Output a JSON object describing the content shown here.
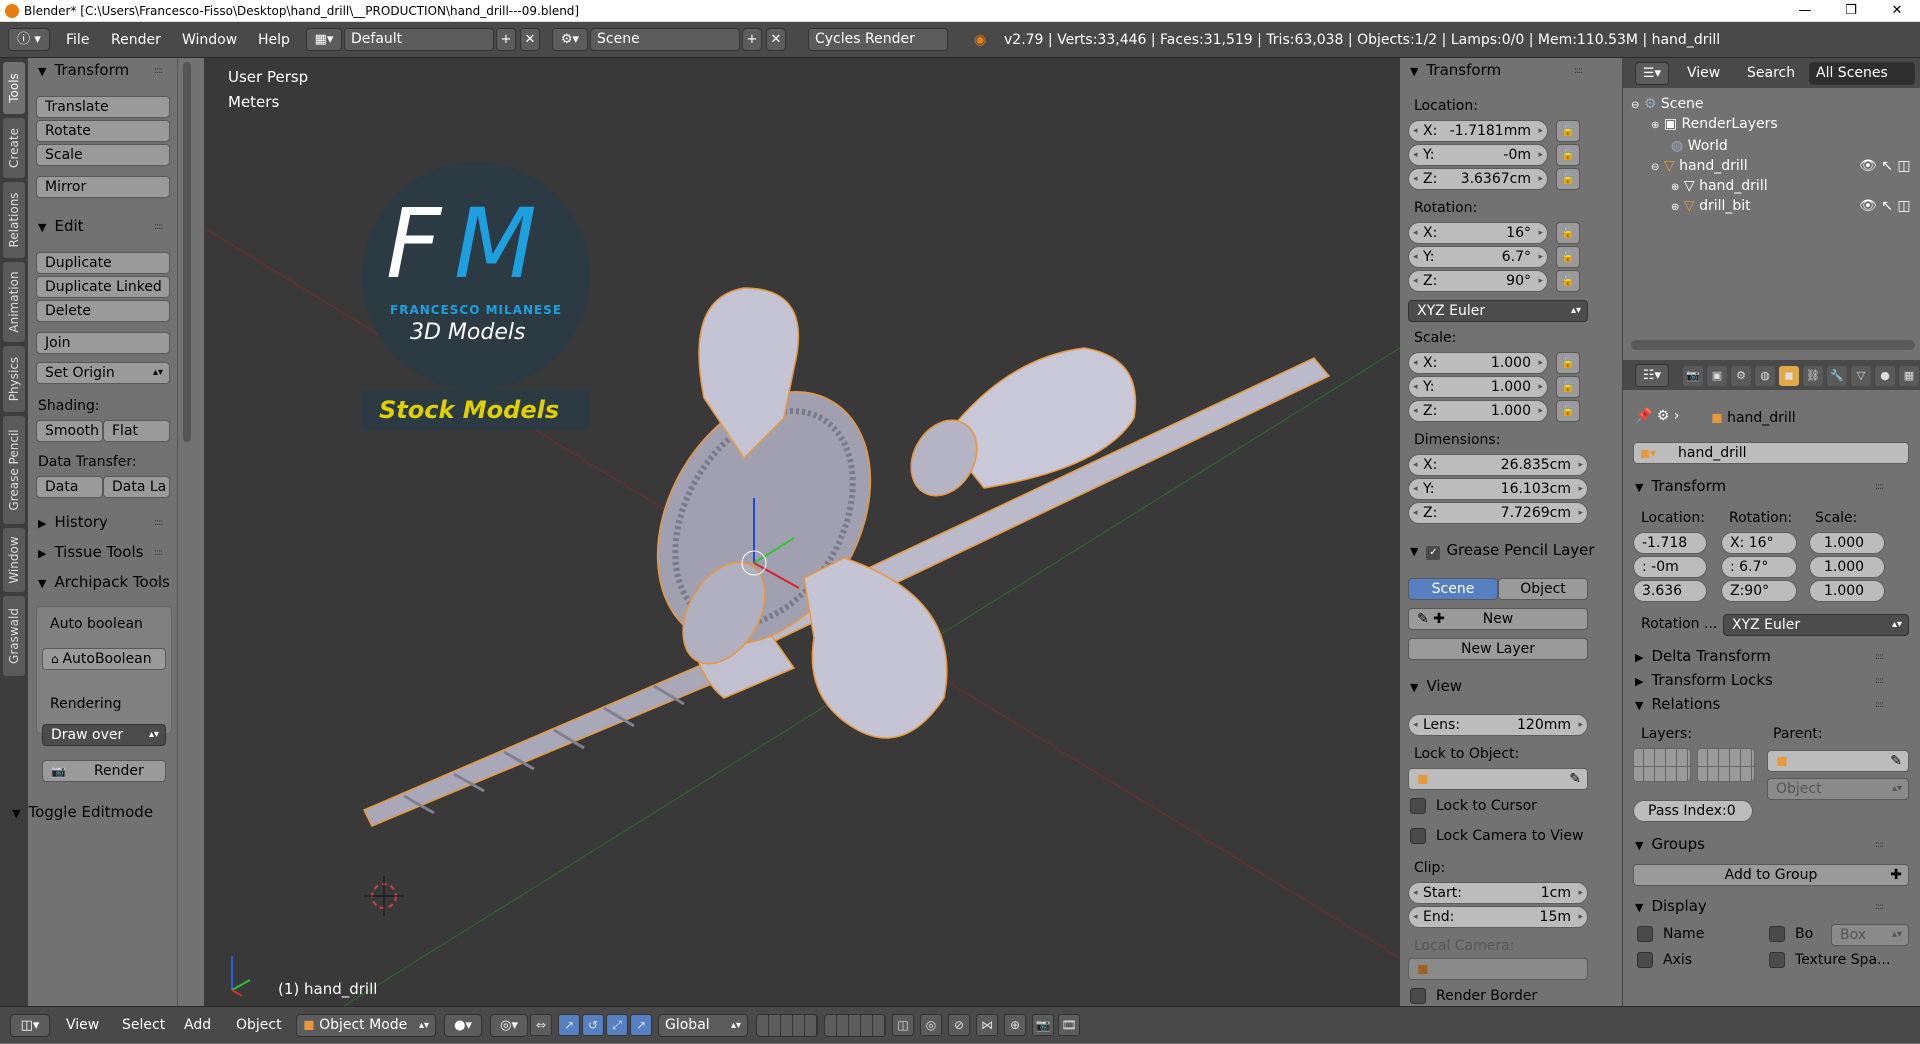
{
  "title_bar": {
    "title": "Blender* [C:\\Users\\Francesco-Fisso\\Desktop\\hand_drill\\__PRODUCTION\\hand_drill---09.blend]"
  },
  "top_bar": {
    "menus": [
      "File",
      "Render",
      "Window",
      "Help"
    ],
    "screen_layout": "Default",
    "scene": "Scene",
    "render_engine": "Cycles Render",
    "stats": "v2.79 | Verts:33,446 | Faces:31,519 | Tris:63,038 | Objects:1/2 | Lamps:0/0 | Mem:110.53M | hand_drill"
  },
  "tool_tabs": [
    "Tools",
    "Create",
    "Relations",
    "Animation",
    "Physics",
    "Grease Pencil",
    "Window",
    "Graswald"
  ],
  "toolshelf": {
    "transform": {
      "header": "Transform",
      "buttons": [
        "Translate",
        "Rotate",
        "Scale",
        "Mirror"
      ]
    },
    "edit": {
      "header": "Edit",
      "buttons": [
        "Duplicate",
        "Duplicate Linked",
        "Delete",
        "Join"
      ],
      "set_origin": "Set Origin",
      "shading_label": "Shading:",
      "smooth": "Smooth",
      "flat": "Flat",
      "data_transfer_label": "Data Transfer:",
      "data": "Data",
      "data_la": "Data La"
    },
    "history": "History",
    "tissue_tools": "Tissue Tools",
    "archipack": "Archipack Tools",
    "auto_boolean_label": "Auto boolean",
    "auto_boolean_btn": "AutoBoolean",
    "rendering_label": "Rendering",
    "draw_over": "Draw over",
    "render_btn": "Render",
    "toggle_editmode": "Toggle Editmode"
  },
  "viewport": {
    "view_name": "User Persp",
    "units": "Meters",
    "object_label": "(1) hand_drill",
    "logo": {
      "letters_f": "F",
      "letters_m": "M",
      "brand": "FRANCESCO MILANESE",
      "sub": "3D Models",
      "banner": "Stock Models"
    },
    "colors": {
      "bg": "#393939",
      "handle": "#b8b8c8",
      "outline": "#e8983a",
      "logo_blue": "#1e9fe0",
      "banner_text": "#e0d000"
    }
  },
  "npanel": {
    "transform_header": "Transform",
    "location_label": "Location:",
    "location": [
      {
        "k": "X:",
        "v": "-1.7181mm"
      },
      {
        "k": "Y:",
        "v": "-0m"
      },
      {
        "k": "Z:",
        "v": "3.6367cm"
      }
    ],
    "rotation_label": "Rotation:",
    "rotation": [
      {
        "k": "X:",
        "v": "16°"
      },
      {
        "k": "Y:",
        "v": "6.7°"
      },
      {
        "k": "Z:",
        "v": "90°"
      }
    ],
    "rotation_mode": "XYZ Euler",
    "scale_label": "Scale:",
    "scale": [
      {
        "k": "X:",
        "v": "1.000"
      },
      {
        "k": "Y:",
        "v": "1.000"
      },
      {
        "k": "Z:",
        "v": "1.000"
      }
    ],
    "dimensions_label": "Dimensions:",
    "dimensions": [
      {
        "k": "X:",
        "v": "26.835cm"
      },
      {
        "k": "Y:",
        "v": "16.103cm"
      },
      {
        "k": "Z:",
        "v": "7.7269cm"
      }
    ],
    "grease_header": "Grease Pencil Layer",
    "scene_btn": "Scene",
    "object_btn": "Object",
    "new_btn": "New",
    "new_layer_btn": "New Layer",
    "view_header": "View",
    "lens_label": "Lens:",
    "lens_value": "120mm",
    "lock_to_object_label": "Lock to Object:",
    "lock_to_cursor": "Lock to Cursor",
    "lock_camera": "Lock Camera to View",
    "clip_label": "Clip:",
    "clip_start_k": "Start:",
    "clip_start_v": "1cm",
    "clip_end_k": "End:",
    "clip_end_v": "15m",
    "local_camera_label": "Local Camera:",
    "render_border": "Render Border"
  },
  "outliner": {
    "view": "View",
    "search": "Search",
    "filter": "All Scenes",
    "items": [
      "Scene",
      "RenderLayers",
      "World",
      "hand_drill",
      "hand_drill",
      "drill_bit"
    ]
  },
  "properties": {
    "breadcrumb": "hand_drill",
    "object_name": "hand_drill",
    "transform_header": "Transform",
    "location_label": "Location:",
    "rotation_label": "Rotation:",
    "scale_label": "Scale:",
    "loc": [
      "-1.718",
      ": -0m",
      "3.636"
    ],
    "rot": [
      "X: 16°",
      ": 6.7°",
      "Z:90°"
    ],
    "scl": [
      "1.000",
      "1.000",
      "1.000"
    ],
    "rotation_mode_label": "Rotation ...",
    "rotation_mode": "XYZ Euler",
    "delta_transform": "Delta Transform",
    "transform_locks": "Transform Locks",
    "relations": "Relations",
    "layers_label": "Layers:",
    "parent_label": "Parent:",
    "parent_type": "Object",
    "pass_index": "Pass Index:0",
    "groups": "Groups",
    "add_to_group": "Add to Group",
    "display": "Display",
    "name_chk": "Name",
    "bo_chk": "Bo",
    "box_dd": "Box",
    "axis_chk": "Axis",
    "texture_space": "Texture Spa..."
  },
  "bottom_bar": {
    "menus": [
      "View",
      "Select",
      "Add",
      "Object"
    ],
    "mode": "Object Mode",
    "orientation": "Global"
  }
}
